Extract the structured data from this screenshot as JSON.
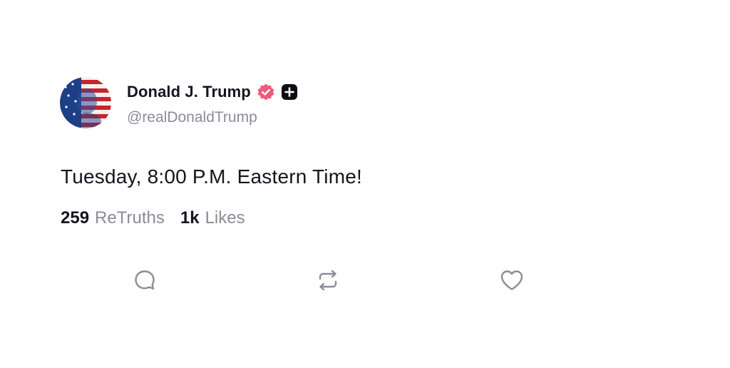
{
  "post": {
    "author": {
      "display_name": "Donald J. Trump",
      "handle": "@realDonaldTrump",
      "verified_icon": "verified-badge-icon",
      "plus_icon": "plus-badge-icon"
    },
    "text": "Tuesday, 8:00 P.M. Eastern Time!",
    "stats": {
      "retruths_count": "259",
      "retruths_label": "ReTruths",
      "likes_count": "1k",
      "likes_label": "Likes"
    },
    "actions": {
      "reply_icon": "reply-icon",
      "retruth_icon": "retruth-icon",
      "like_icon": "heart-icon"
    }
  },
  "colors": {
    "text_primary": "#17131f",
    "text_secondary": "#8f8a97",
    "verified_badge": "#ef5b7b",
    "icon_gray": "#8f8a97"
  }
}
